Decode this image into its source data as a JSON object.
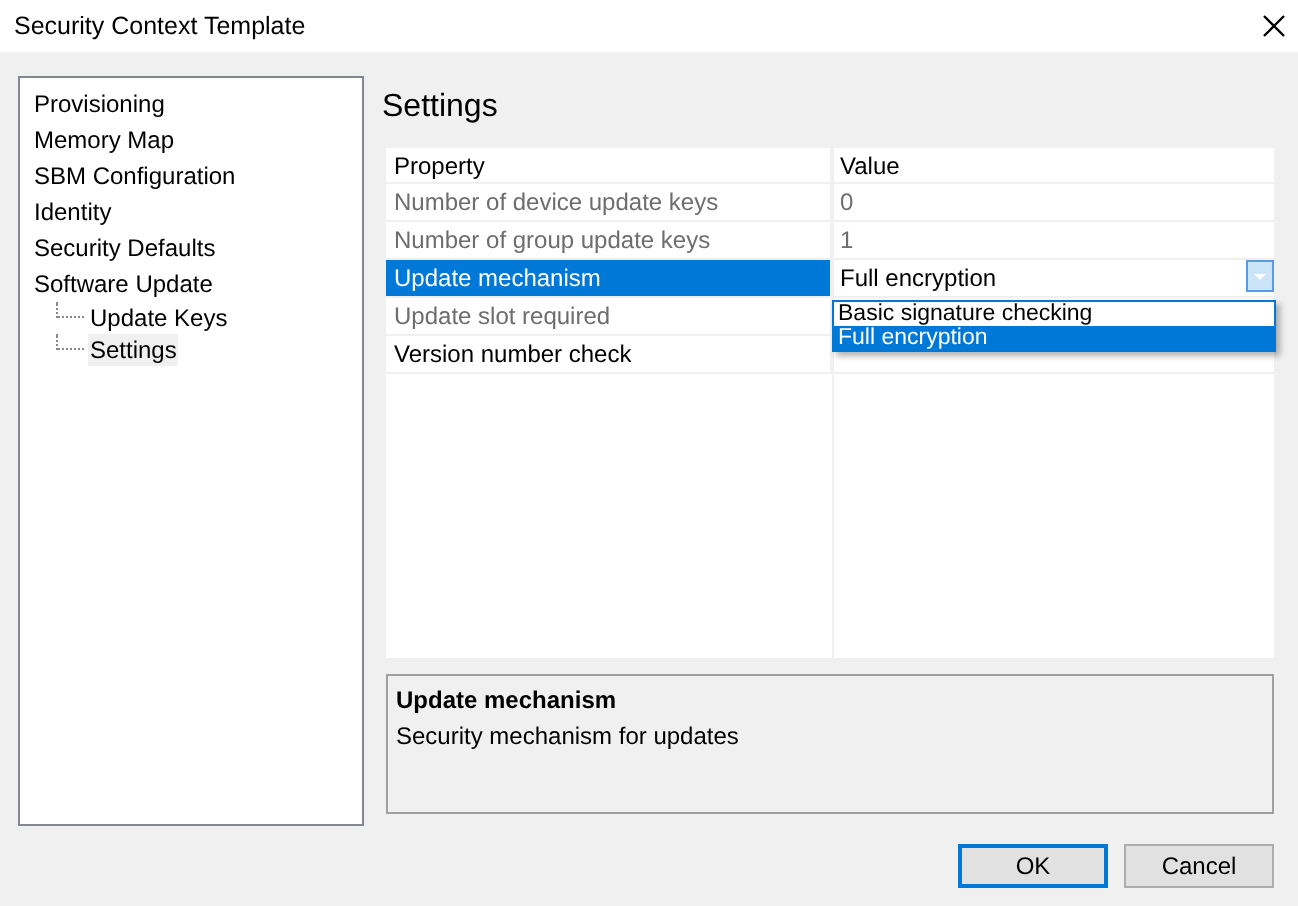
{
  "window": {
    "title": "Security Context Template"
  },
  "tree": [
    {
      "label": "Provisioning",
      "selected": false
    },
    {
      "label": "Memory Map",
      "selected": false
    },
    {
      "label": "SBM Configuration",
      "selected": false
    },
    {
      "label": "Identity",
      "selected": false
    },
    {
      "label": "Security Defaults",
      "selected": false
    },
    {
      "label": "Software Update",
      "selected": false,
      "children": [
        {
          "label": "Update Keys",
          "selected": false
        },
        {
          "label": "Settings",
          "selected": true
        }
      ]
    }
  ],
  "heading": "Settings",
  "grid": {
    "columns": [
      "Property",
      "Value"
    ],
    "rows": [
      {
        "property": "Number of device update keys",
        "value": "0",
        "disabled": true,
        "selected": false,
        "kind": "text"
      },
      {
        "property": "Number of group update keys",
        "value": "1",
        "disabled": true,
        "selected": false,
        "kind": "text"
      },
      {
        "property": "Update mechanism",
        "value": "Full encryption",
        "disabled": false,
        "selected": true,
        "kind": "combo",
        "expanded": true,
        "options": [
          {
            "label": "Basic signature checking",
            "selected": false
          },
          {
            "label": "Full encryption",
            "selected": true
          }
        ]
      },
      {
        "property": "Update slot required",
        "disabled": true,
        "selected": false,
        "kind": "text"
      },
      {
        "property": "Version number check",
        "disabled": false,
        "selected": false,
        "kind": "text"
      }
    ]
  },
  "description": {
    "title": "Update mechanism",
    "text": "Security mechanism for updates"
  },
  "buttons": [
    {
      "label": "OK",
      "default": true
    },
    {
      "label": "Cancel",
      "default": false
    }
  ]
}
